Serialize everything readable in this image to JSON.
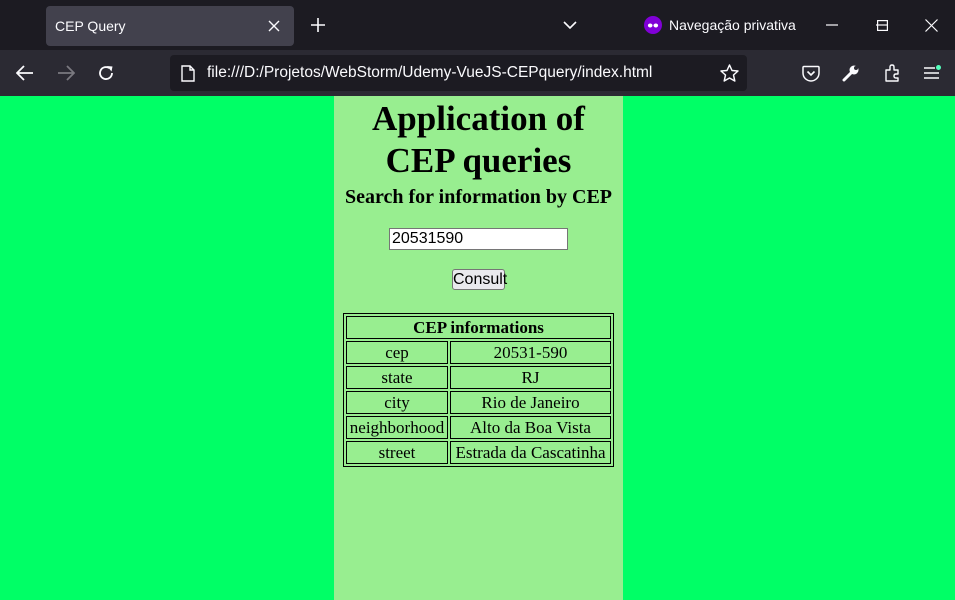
{
  "browser": {
    "tab_title": "CEP Query",
    "private_label": "Navegação privativa",
    "url": "file:///D:/Projetos/WebStorm/Udemy-VueJS-CEPquery/index.html",
    "colors": {
      "tabbar": "#1c1b22",
      "navbar": "#2b2a33",
      "private_icon": "#8000d7"
    }
  },
  "page": {
    "title": "Application of CEP queries",
    "subtitle": "Search for information by CEP",
    "cep_value": "20531590",
    "consult_label": "Consult",
    "colors": {
      "background": "#00ff66",
      "panel": "#98ee90"
    },
    "table": {
      "header": "CEP informations",
      "rows": [
        {
          "label": "cep",
          "value": "20531-590"
        },
        {
          "label": "state",
          "value": "RJ"
        },
        {
          "label": "city",
          "value": "Rio de Janeiro"
        },
        {
          "label": "neighborhood",
          "value": "Alto da Boa Vista"
        },
        {
          "label": "street",
          "value": "Estrada da Cascatinha"
        }
      ]
    }
  }
}
